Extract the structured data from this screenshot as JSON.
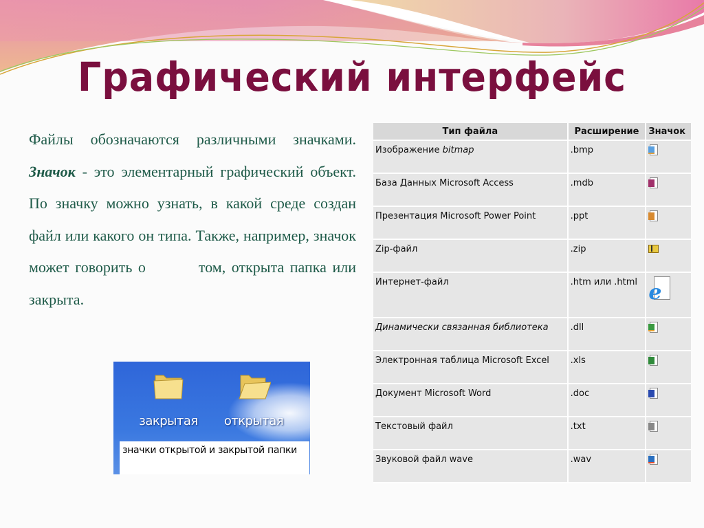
{
  "slide": {
    "title": "Графический интерфейс",
    "body": {
      "part1": "Файлы обозначаются различными значками. ",
      "keyword": "Значок",
      "part2": " - это элементарный графический объект. По значку можно узнать, в какой среде создан файл или какого он типа. Также, например, значок может говорить о         том, открыта папка или закрыта."
    },
    "folders_image": {
      "closed_label": "закрытая",
      "open_label": "открытая",
      "caption": "значки открытой и закрытой папки"
    },
    "colors": {
      "title": "#7a0f3e",
      "body_text": "#1e5a48",
      "table_header_bg": "#d8d8d8",
      "table_cell_bg": "#e6e6e6"
    }
  },
  "table": {
    "headers": [
      "Тип файла",
      "Расширение",
      "Значок"
    ],
    "rows": [
      {
        "type_prefix": "Изображение ",
        "type_italic": "bitmap",
        "ext": ".bmp",
        "icon": "bitmap-icon"
      },
      {
        "type_prefix": "База Данных Microsoft Access",
        "type_italic": "",
        "ext": ".mdb",
        "icon": "access-icon"
      },
      {
        "type_prefix": "Презентация Microsoft Power Point",
        "type_italic": "",
        "ext": ".ppt",
        "icon": "powerpoint-icon"
      },
      {
        "type_prefix": "Zip-файл",
        "type_italic": "",
        "ext": ".zip",
        "icon": "zip-icon"
      },
      {
        "type_prefix": "Интернет-файл",
        "type_italic": "",
        "ext": ".htm или .html",
        "icon": "internet-explorer-icon"
      },
      {
        "type_prefix": "",
        "type_italic": "Динамически связанная библиотека",
        "ext": ".dll",
        "icon": "dll-icon"
      },
      {
        "type_prefix": "Электронная таблица Microsoft Excel",
        "type_italic": "",
        "ext": ".xls",
        "icon": "excel-icon"
      },
      {
        "type_prefix": "Документ Microsoft Word",
        "type_italic": "",
        "ext": ".doc",
        "icon": "word-icon"
      },
      {
        "type_prefix": "Текстовый файл",
        "type_italic": "",
        "ext": ".txt",
        "icon": "text-file-icon"
      },
      {
        "type_prefix": "Звуковой файл wave",
        "type_italic": "",
        "ext": ".wav",
        "icon": "wave-audio-icon"
      }
    ]
  }
}
